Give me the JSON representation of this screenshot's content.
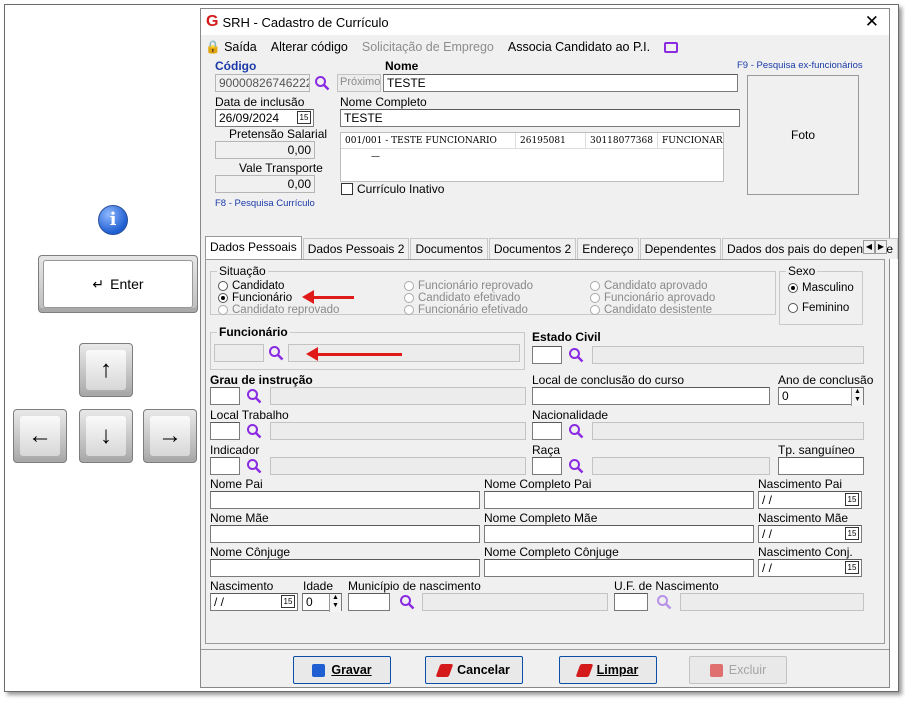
{
  "help": {
    "info_icon": "i",
    "enter_key": "Enter",
    "arrow_up": "↑",
    "arrow_left": "←",
    "arrow_down": "↓",
    "arrow_right": "→"
  },
  "window": {
    "title": "SRH - Cadastro de Currículo",
    "close": "✕"
  },
  "menu": {
    "saida": "Saída",
    "alterar": "Alterar código",
    "solicitacao": "Solicitação de Emprego",
    "associa": "Associa Candidato ao P.I."
  },
  "header": {
    "codigo_label": "Código",
    "codigo_value": "90000826746222",
    "proximo": "Próximo",
    "nome_label": "Nome",
    "nome_value": "TESTE",
    "f9_hint": "F9 - Pesquisa ex-funcionários",
    "data_label": "Data de inclusão",
    "data_value": "26/09/2024",
    "nome_completo_label": "Nome Completo",
    "nome_completo_value": "TESTE",
    "pretensao_label": "Pretensão Salarial",
    "pretensao_value": "0,00",
    "vale_label": "Vale Transporte",
    "vale_value": "0,00",
    "f8_hint": "F8 - Pesquisa Currículo",
    "curriculo_inativo": "Currículo Inativo",
    "foto": "Foto"
  },
  "grid": {
    "rows": [
      [
        "001/001 - TESTE FUNCIONARIO",
        "26195081",
        "30118077368",
        "FUNCIONARIO"
      ],
      [
        "—",
        "",
        "",
        ""
      ]
    ]
  },
  "tabs": [
    "Dados Pessoais",
    "Dados Pessoais 2",
    "Documentos",
    "Documentos 2",
    "Endereço",
    "Dependentes",
    "Dados dos pais do dependente"
  ],
  "situacao": {
    "title": "Situação",
    "options": [
      {
        "label": "Candidato",
        "enabled": true,
        "selected": false
      },
      {
        "label": "Funcionário",
        "enabled": true,
        "selected": true
      },
      {
        "label": "Candidato reprovado",
        "enabled": false,
        "selected": false
      },
      {
        "label": "Funcionário reprovado",
        "enabled": false,
        "selected": false
      },
      {
        "label": "Candidato efetivado",
        "enabled": false,
        "selected": false
      },
      {
        "label": "Funcionário efetivado",
        "enabled": false,
        "selected": false
      },
      {
        "label": "Candidato aprovado",
        "enabled": false,
        "selected": false
      },
      {
        "label": "Funcionário aprovado",
        "enabled": false,
        "selected": false
      },
      {
        "label": "Candidato desistente",
        "enabled": false,
        "selected": false
      }
    ]
  },
  "sexo": {
    "title": "Sexo",
    "masculino": "Masculino",
    "feminino": "Feminino"
  },
  "form": {
    "funcionario_label": "Funcionário",
    "estado_civil_label": "Estado Civil",
    "grau_label": "Grau de instrução",
    "local_conclusao_label": "Local de conclusão do curso",
    "ano_conclusao_label": "Ano de conclusão",
    "ano_conclusao_value": "0",
    "local_trabalho_label": "Local Trabalho",
    "nacionalidade_label": "Nacionalidade",
    "indicador_label": "Indicador",
    "raca_label": "Raça",
    "tp_sanguineo_label": "Tp. sanguíneo",
    "nome_pai_label": "Nome Pai",
    "nome_completo_pai_label": "Nome Completo Pai",
    "nascimento_pai_label": "Nascimento Pai",
    "nome_mae_label": "Nome Mãe",
    "nome_completo_mae_label": "Nome Completo Mãe",
    "nascimento_mae_label": "Nascimento Mãe",
    "nome_conjuge_label": "Nome Cônjuge",
    "nome_completo_conjuge_label": "Nome Completo Cônjuge",
    "nascimento_conj_label": "Nascimento Conj.",
    "nascimento_label": "Nascimento",
    "idade_label": "Idade",
    "idade_value": "0",
    "municipio_label": "Município de nascimento",
    "uf_label": "U.F. de Nascimento",
    "date_placeholder": " / /",
    "cal_icon": "15"
  },
  "buttons": {
    "gravar": "Gravar",
    "cancelar": "Cancelar",
    "limpar": "Limpar",
    "excluir": "Excluir"
  },
  "colors": {
    "accent_blue": "#1a3aa8",
    "arrow_red": "#e01919",
    "search_purple": "#8a2be2"
  }
}
